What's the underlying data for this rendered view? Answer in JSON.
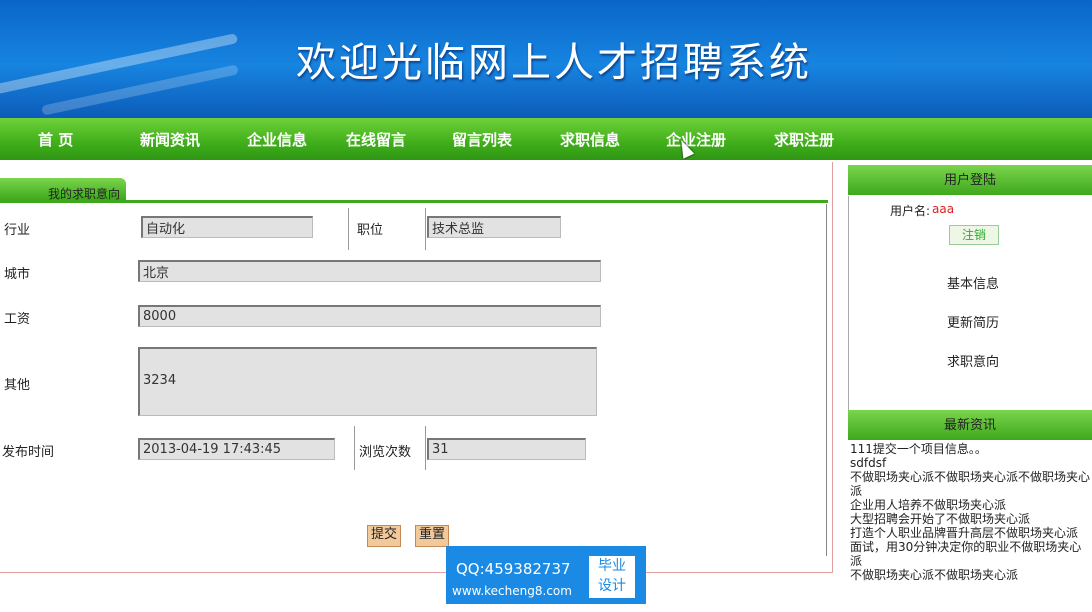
{
  "banner": {
    "title": "欢迎光临网上人才招聘系统"
  },
  "nav": {
    "items": [
      "首 页",
      "新闻资讯",
      "企业信息",
      "在线留言",
      "留言列表",
      "求职信息",
      "企业注册",
      "求职注册"
    ]
  },
  "panel": {
    "tab_label": "我的求职意向"
  },
  "form": {
    "industry_label": "行业",
    "industry_value": "自动化",
    "position_label": "职位",
    "position_value": "技术总监",
    "city_label": "城市",
    "city_value": "北京",
    "salary_label": "工资",
    "salary_value": "8000",
    "other_label": "其他",
    "other_value": "3234",
    "publish_time_label": "发布时间",
    "publish_time_value": "2013-04-19 17:43:45",
    "views_label": "浏览次数",
    "views_value": "31",
    "submit_label": "提交",
    "reset_label": "重置"
  },
  "sidebar": {
    "login_header": "用户登陆",
    "username_label": "用户名:",
    "username_value": "aaa",
    "logout_label": "注销",
    "links": [
      "基本信息",
      "更新简历",
      "求职意向"
    ],
    "news_header": "最新资讯",
    "news_items": [
      "111提交一个项目信息。。",
      "sdfdsf",
      "不做职场夹心派不做职场夹心派不做职场夹心派",
      "企业用人培养不做职场夹心派",
      "大型招聘会开始了不做职场夹心派",
      "打造个人职业品牌晋升高层不做职场夹心派",
      "面试，用30分钟决定你的职业不做职场夹心派",
      "不做职场夹心派不做职场夹心派"
    ]
  },
  "watermark": {
    "qq": "QQ:459382737",
    "url": "www.kecheng8.com",
    "badge_line1": "毕业",
    "badge_line2": "设计"
  },
  "colors": {
    "banner_blue": "#1784e0",
    "nav_green": "#3fae1a",
    "username_red": "#e02020",
    "input_gray": "#e2e2e2"
  }
}
